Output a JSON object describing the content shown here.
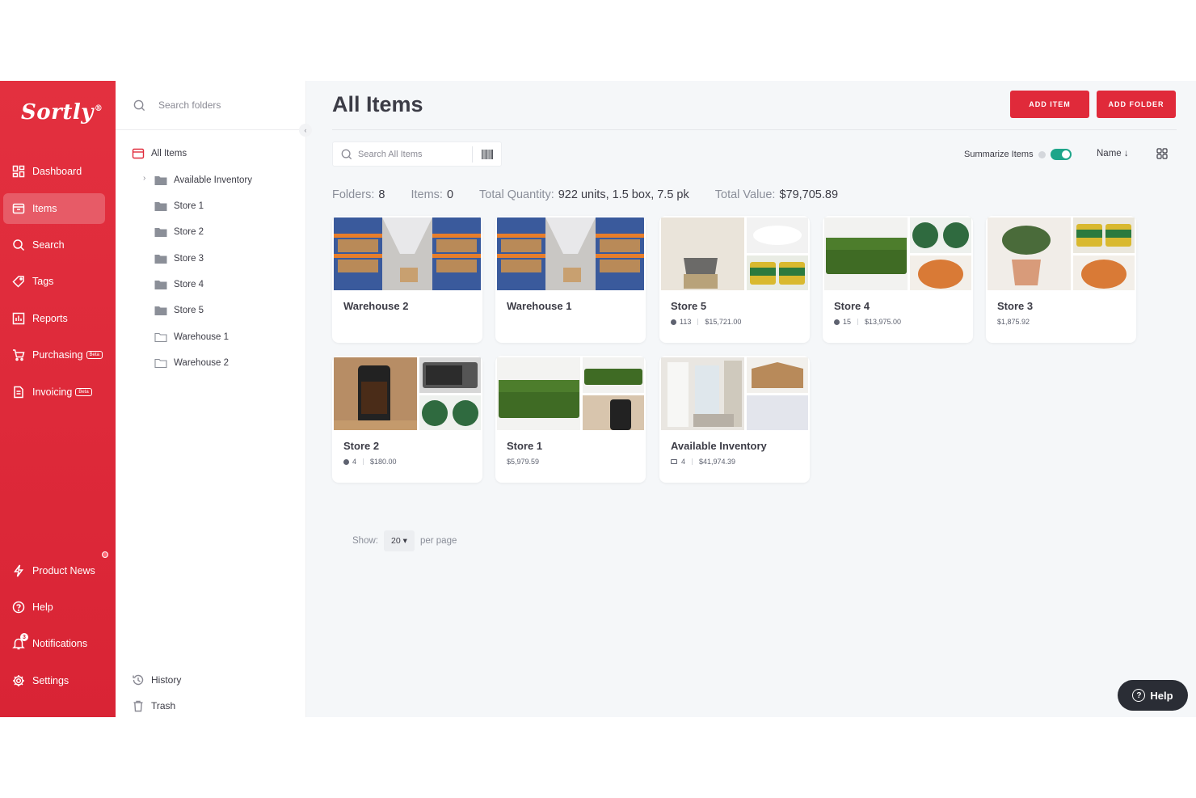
{
  "brand": {
    "logo": "Sortly",
    "reg": "®"
  },
  "nav": {
    "items": [
      {
        "label": "Dashboard",
        "icon": "dashboard-icon"
      },
      {
        "label": "Items",
        "icon": "items-icon"
      },
      {
        "label": "Search",
        "icon": "search-icon"
      },
      {
        "label": "Tags",
        "icon": "tag-icon"
      },
      {
        "label": "Reports",
        "icon": "reports-icon"
      },
      {
        "label": "Purchasing",
        "icon": "cart-icon",
        "beta": "Beta"
      },
      {
        "label": "Invoicing",
        "icon": "invoice-icon",
        "beta": "Beta"
      }
    ],
    "bottom": [
      {
        "label": "Product News",
        "icon": "bolt-icon"
      },
      {
        "label": "Help",
        "icon": "help-icon"
      },
      {
        "label": "Notifications",
        "icon": "bell-icon",
        "count": "3"
      },
      {
        "label": "Settings",
        "icon": "gear-icon"
      }
    ],
    "active": "Items"
  },
  "folders": {
    "search_placeholder": "Search folders",
    "root": "All Items",
    "tree": [
      "Available Inventory",
      "Store 1",
      "Store 2",
      "Store 3",
      "Store 4",
      "Store 5",
      "Warehouse 1",
      "Warehouse 2"
    ],
    "history": "History",
    "trash": "Trash"
  },
  "main": {
    "title": "All Items",
    "add_item": "ADD ITEM",
    "add_folder": "ADD FOLDER",
    "search_placeholder": "Search All Items",
    "summarize_label": "Summarize Items",
    "summarize_on": true,
    "sort_label": "Name",
    "stats": {
      "folders_label": "Folders:",
      "folders": "8",
      "items_label": "Items:",
      "items": "0",
      "qty_label": "Total Quantity:",
      "qty": "922 units, 1.5 box, 7.5 pk",
      "value_label": "Total Value:",
      "value": "$79,705.89"
    },
    "cards": [
      {
        "name": "Warehouse 2",
        "count": "",
        "value": ""
      },
      {
        "name": "Warehouse 1",
        "count": "",
        "value": ""
      },
      {
        "name": "Store 5",
        "count": "113",
        "value": "$15,721.00"
      },
      {
        "name": "Store 4",
        "count": "15",
        "value": "$13,975.00"
      },
      {
        "name": "Store 3",
        "count": "",
        "value": "$1,875.92"
      },
      {
        "name": "Store 2",
        "count": "4",
        "value": "$180.00"
      },
      {
        "name": "Store 1",
        "count": "",
        "value": "$5,979.59"
      },
      {
        "name": "Available Inventory",
        "count": "4",
        "value": "$41,974.39"
      }
    ],
    "pager": {
      "show": "Show:",
      "per_page_value": "20",
      "per_page": "per page"
    }
  },
  "help_button": "Help",
  "colors": {
    "brand_red": "#e02a3a",
    "toggle_green": "#1ea58a",
    "folder_grey": "#8b8f98"
  }
}
